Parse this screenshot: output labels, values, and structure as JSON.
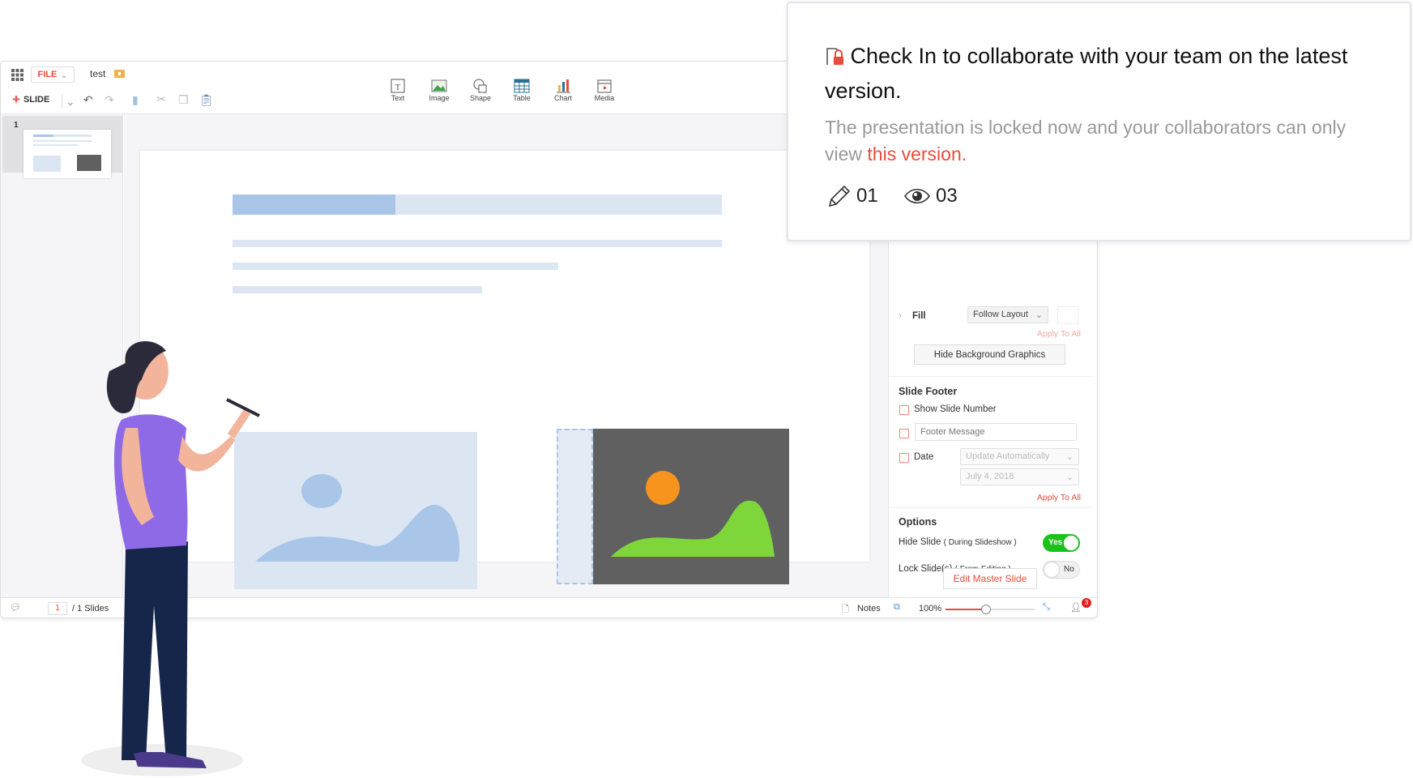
{
  "topbar": {
    "file_label": "FILE",
    "doc_title": "test"
  },
  "toolbar": {
    "slide_label": "SLIDE",
    "insert": [
      {
        "label": "Text",
        "icon": "text-box-icon"
      },
      {
        "label": "Image",
        "icon": "image-icon"
      },
      {
        "label": "Shape",
        "icon": "shape-icon"
      },
      {
        "label": "Table",
        "icon": "table-icon"
      },
      {
        "label": "Chart",
        "icon": "chart-icon"
      },
      {
        "label": "Media",
        "icon": "media-icon"
      }
    ]
  },
  "sidebar": {
    "thumb_number": "1"
  },
  "panel": {
    "fill_label": "Fill",
    "fill_value": "Follow Layout",
    "apply_all_1": "Apply To All",
    "hide_bg_button": "Hide Background Graphics",
    "footer_title": "Slide Footer",
    "show_slide_number": "Show Slide Number",
    "footer_message_placeholder": "Footer Message",
    "date_label": "Date",
    "date_mode": "Update Automatically",
    "date_value": "July 4, 2018",
    "apply_all_2": "Apply To All",
    "options_title": "Options",
    "hide_slide_label": "Hide Slide",
    "hide_slide_sub": "( During Slideshow )",
    "hide_slide_value": "Yes",
    "lock_slide_label": "Lock Slide(s)",
    "lock_slide_sub": "( From Editing )",
    "lock_slide_value": "No",
    "edit_master_button": "Edit Master Slide"
  },
  "status": {
    "page_current": "1",
    "page_total": "/ 1 Slides",
    "notes_label": "Notes",
    "zoom": "100%",
    "zoom_level": 0.45,
    "collab_badge": "3"
  },
  "popup": {
    "title": "Check In to collaborate with your team on the latest version.",
    "body": "The presentation is locked now and your collaborators can only view ",
    "body_link": "this version.",
    "editors_count": "01",
    "viewers_count": "03"
  },
  "colors": {
    "accent": "#e74c3c",
    "toggle_on": "#1bc21b",
    "slide_placeholder": "#dce6f3",
    "image_dark": "#606060",
    "sun": "#f7941d",
    "hill": "#7ed63a"
  }
}
